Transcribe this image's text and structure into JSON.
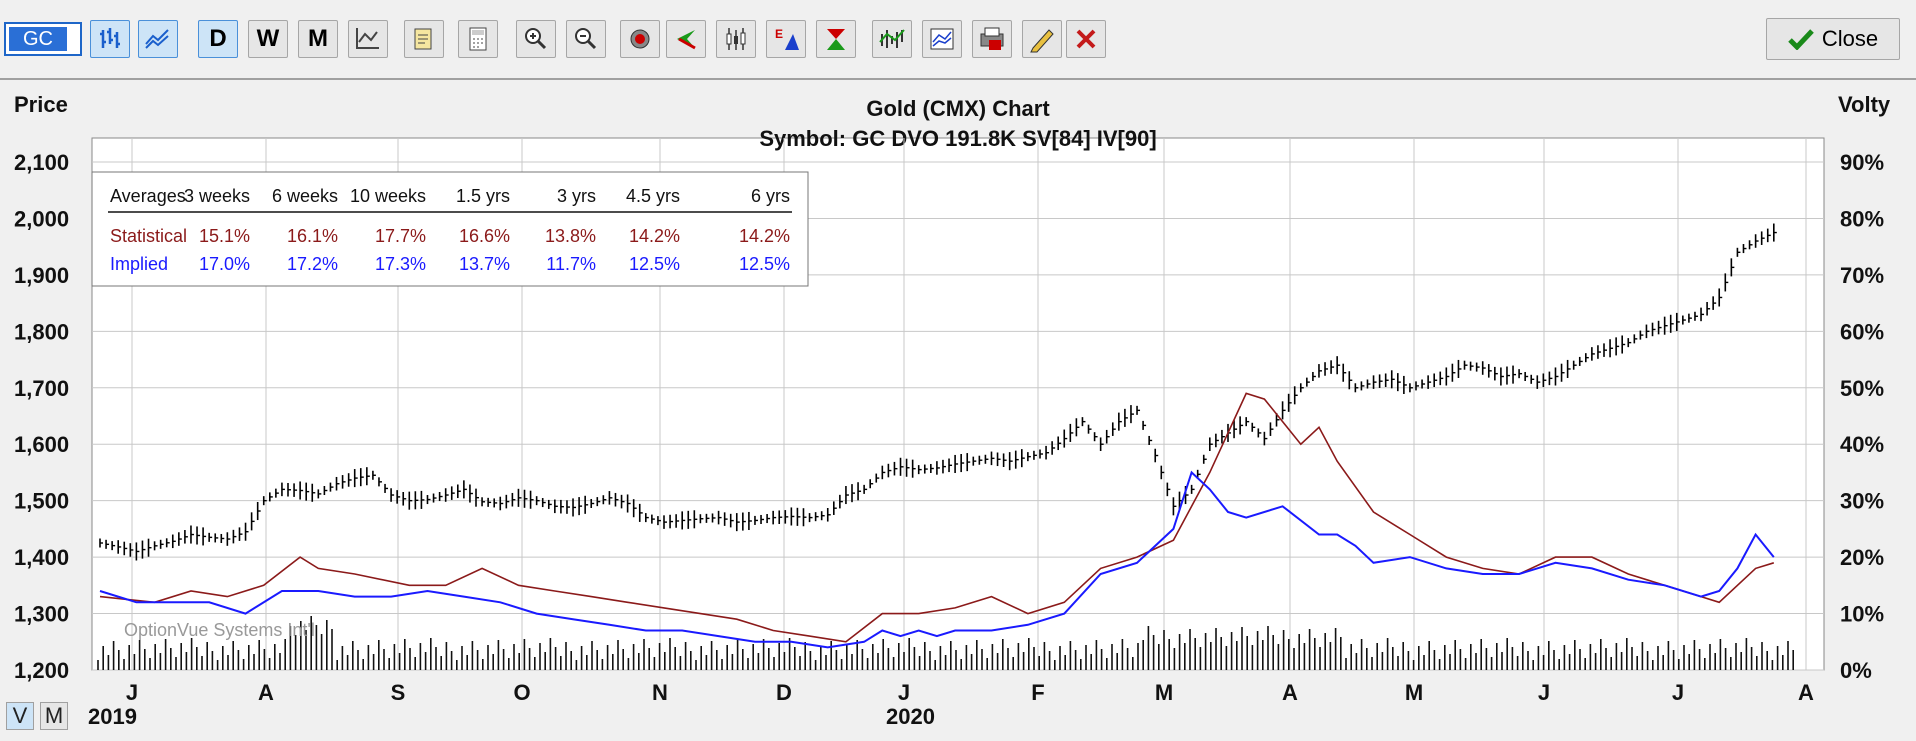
{
  "toolbar": {
    "symbol": "GC",
    "buttons": [
      {
        "name": "bar-chart-icon",
        "label": ""
      },
      {
        "name": "line-chart-icon",
        "label": ""
      },
      {
        "name": "daily-button",
        "label": "D"
      },
      {
        "name": "weekly-button",
        "label": "W"
      },
      {
        "name": "monthly-button",
        "label": "M"
      },
      {
        "name": "chart-options-icon",
        "label": ""
      },
      {
        "name": "clipboard-icon",
        "label": ""
      },
      {
        "name": "calculator-icon",
        "label": ""
      },
      {
        "name": "zoom-in-icon",
        "label": ""
      },
      {
        "name": "zoom-out-icon",
        "label": ""
      },
      {
        "name": "target-icon",
        "label": ""
      },
      {
        "name": "arrow-left-icon",
        "label": ""
      },
      {
        "name": "candles-icon",
        "label": ""
      },
      {
        "name": "earnings-icon",
        "label": ""
      },
      {
        "name": "dividend-icon",
        "label": ""
      },
      {
        "name": "indicators-icon",
        "label": ""
      },
      {
        "name": "studies-icon",
        "label": ""
      },
      {
        "name": "print-icon",
        "label": ""
      },
      {
        "name": "pencil-icon",
        "label": ""
      },
      {
        "name": "delete-icon",
        "label": ""
      }
    ],
    "close_label": "Close"
  },
  "colors": {
    "statistical": "#8b1a1a",
    "implied": "#1a1aff",
    "price": "#000000",
    "grid": "#c8c8c8"
  },
  "chart_data": {
    "type": "line",
    "title": "Gold (CMX) Chart",
    "subtitle": "Symbol: GC  DVO 191.8K  SV[84]  IV[90]",
    "ylabel": "Price",
    "y2label": "Volty",
    "ylim": [
      1200,
      2100
    ],
    "y2lim": [
      0,
      90
    ],
    "yticks": [
      "2,100",
      "2,000",
      "1,900",
      "1,800",
      "1,700",
      "1,600",
      "1,500",
      "1,400",
      "1,300",
      "1,200"
    ],
    "y2ticks": [
      "90%",
      "80%",
      "70%",
      "60%",
      "50%",
      "40%",
      "30%",
      "20%",
      "10%",
      "0%"
    ],
    "months": [
      "J",
      "A",
      "S",
      "O",
      "N",
      "D",
      "J",
      "F",
      "M",
      "A",
      "M",
      "J",
      "J",
      "A"
    ],
    "years": [
      "2019",
      "2020"
    ],
    "watermark": "OptionVue Systems Int'l",
    "averages_table": {
      "header": [
        "Averages",
        "3 weeks",
        "6 weeks",
        "10 weeks",
        "1.5 yrs",
        "3 yrs",
        "4.5 yrs",
        "6 yrs"
      ],
      "rows": [
        {
          "label": "Statistical",
          "values": [
            "15.1%",
            "16.1%",
            "17.7%",
            "16.6%",
            "13.8%",
            "14.2%",
            "14.2%"
          ]
        },
        {
          "label": "Implied",
          "values": [
            "17.0%",
            "17.2%",
            "17.3%",
            "13.7%",
            "11.7%",
            "12.5%",
            "12.5%"
          ]
        }
      ]
    },
    "price_series": [
      [
        0,
        1425
      ],
      [
        2,
        1418
      ],
      [
        4,
        1410
      ],
      [
        6,
        1420
      ],
      [
        8,
        1428
      ],
      [
        10,
        1440
      ],
      [
        12,
        1435
      ],
      [
        14,
        1432
      ],
      [
        16,
        1445
      ],
      [
        18,
        1500
      ],
      [
        20,
        1520
      ],
      [
        22,
        1518
      ],
      [
        24,
        1512
      ],
      [
        26,
        1530
      ],
      [
        28,
        1540
      ],
      [
        30,
        1545
      ],
      [
        32,
        1510
      ],
      [
        34,
        1500
      ],
      [
        36,
        1502
      ],
      [
        38,
        1510
      ],
      [
        40,
        1520
      ],
      [
        42,
        1498
      ],
      [
        44,
        1495
      ],
      [
        46,
        1505
      ],
      [
        48,
        1500
      ],
      [
        50,
        1490
      ],
      [
        52,
        1488
      ],
      [
        54,
        1495
      ],
      [
        56,
        1505
      ],
      [
        58,
        1495
      ],
      [
        60,
        1470
      ],
      [
        62,
        1462
      ],
      [
        64,
        1465
      ],
      [
        66,
        1468
      ],
      [
        68,
        1470
      ],
      [
        70,
        1462
      ],
      [
        72,
        1465
      ],
      [
        74,
        1470
      ],
      [
        76,
        1472
      ],
      [
        78,
        1470
      ],
      [
        80,
        1475
      ],
      [
        82,
        1510
      ],
      [
        84,
        1520
      ],
      [
        86,
        1550
      ],
      [
        88,
        1560
      ],
      [
        90,
        1555
      ],
      [
        92,
        1558
      ],
      [
        94,
        1565
      ],
      [
        96,
        1570
      ],
      [
        98,
        1575
      ],
      [
        100,
        1570
      ],
      [
        102,
        1578
      ],
      [
        104,
        1585
      ],
      [
        106,
        1610
      ],
      [
        108,
        1640
      ],
      [
        110,
        1600
      ],
      [
        112,
        1640
      ],
      [
        114,
        1660
      ],
      [
        116,
        1580
      ],
      [
        118,
        1490
      ],
      [
        120,
        1520
      ],
      [
        122,
        1600
      ],
      [
        124,
        1620
      ],
      [
        126,
        1640
      ],
      [
        128,
        1610
      ],
      [
        130,
        1660
      ],
      [
        132,
        1700
      ],
      [
        134,
        1730
      ],
      [
        136,
        1740
      ],
      [
        138,
        1700
      ],
      [
        140,
        1710
      ],
      [
        142,
        1715
      ],
      [
        144,
        1700
      ],
      [
        146,
        1710
      ],
      [
        148,
        1720
      ],
      [
        150,
        1740
      ],
      [
        152,
        1735
      ],
      [
        154,
        1720
      ],
      [
        156,
        1725
      ],
      [
        158,
        1710
      ],
      [
        160,
        1720
      ],
      [
        162,
        1740
      ],
      [
        164,
        1760
      ],
      [
        166,
        1770
      ],
      [
        168,
        1780
      ],
      [
        170,
        1800
      ],
      [
        172,
        1810
      ],
      [
        174,
        1820
      ],
      [
        176,
        1830
      ],
      [
        178,
        1860
      ],
      [
        180,
        1940
      ],
      [
        182,
        1960
      ],
      [
        184,
        1975
      ]
    ],
    "statistical_series": [
      [
        0,
        13
      ],
      [
        6,
        12
      ],
      [
        10,
        14
      ],
      [
        14,
        13
      ],
      [
        18,
        15
      ],
      [
        22,
        20
      ],
      [
        24,
        18
      ],
      [
        28,
        17
      ],
      [
        34,
        15
      ],
      [
        38,
        15
      ],
      [
        42,
        18
      ],
      [
        46,
        15
      ],
      [
        50,
        14
      ],
      [
        54,
        13
      ],
      [
        58,
        12
      ],
      [
        62,
        11
      ],
      [
        66,
        10
      ],
      [
        70,
        9
      ],
      [
        74,
        7
      ],
      [
        78,
        6
      ],
      [
        82,
        5
      ],
      [
        86,
        10
      ],
      [
        90,
        10
      ],
      [
        94,
        11
      ],
      [
        98,
        13
      ],
      [
        102,
        10
      ],
      [
        106,
        12
      ],
      [
        110,
        18
      ],
      [
        114,
        20
      ],
      [
        118,
        23
      ],
      [
        122,
        35
      ],
      [
        126,
        49
      ],
      [
        128,
        48
      ],
      [
        130,
        44
      ],
      [
        132,
        40
      ],
      [
        134,
        43
      ],
      [
        136,
        37
      ],
      [
        140,
        28
      ],
      [
        144,
        24
      ],
      [
        148,
        20
      ],
      [
        152,
        18
      ],
      [
        156,
        17
      ],
      [
        160,
        20
      ],
      [
        164,
        20
      ],
      [
        168,
        17
      ],
      [
        172,
        15
      ],
      [
        176,
        13
      ],
      [
        178,
        12
      ],
      [
        182,
        18
      ],
      [
        184,
        19
      ]
    ],
    "implied_series": [
      [
        0,
        14
      ],
      [
        4,
        12
      ],
      [
        8,
        12
      ],
      [
        12,
        12
      ],
      [
        16,
        10
      ],
      [
        20,
        14
      ],
      [
        24,
        14
      ],
      [
        28,
        13
      ],
      [
        32,
        13
      ],
      [
        36,
        14
      ],
      [
        40,
        13
      ],
      [
        44,
        12
      ],
      [
        48,
        10
      ],
      [
        52,
        9
      ],
      [
        56,
        8
      ],
      [
        60,
        7
      ],
      [
        64,
        7
      ],
      [
        68,
        6
      ],
      [
        72,
        5
      ],
      [
        76,
        5
      ],
      [
        80,
        4
      ],
      [
        84,
        5
      ],
      [
        86,
        7
      ],
      [
        88,
        6
      ],
      [
        90,
        7
      ],
      [
        92,
        6
      ],
      [
        94,
        7
      ],
      [
        96,
        7
      ],
      [
        98,
        7
      ],
      [
        102,
        8
      ],
      [
        106,
        10
      ],
      [
        110,
        17
      ],
      [
        114,
        19
      ],
      [
        118,
        25
      ],
      [
        120,
        35
      ],
      [
        122,
        32
      ],
      [
        124,
        28
      ],
      [
        126,
        27
      ],
      [
        130,
        29
      ],
      [
        134,
        24
      ],
      [
        136,
        24
      ],
      [
        138,
        22
      ],
      [
        140,
        19
      ],
      [
        144,
        20
      ],
      [
        148,
        18
      ],
      [
        152,
        17
      ],
      [
        156,
        17
      ],
      [
        160,
        19
      ],
      [
        164,
        18
      ],
      [
        168,
        16
      ],
      [
        172,
        15
      ],
      [
        176,
        13
      ],
      [
        178,
        14
      ],
      [
        180,
        18
      ],
      [
        182,
        24
      ],
      [
        184,
        20
      ]
    ]
  }
}
